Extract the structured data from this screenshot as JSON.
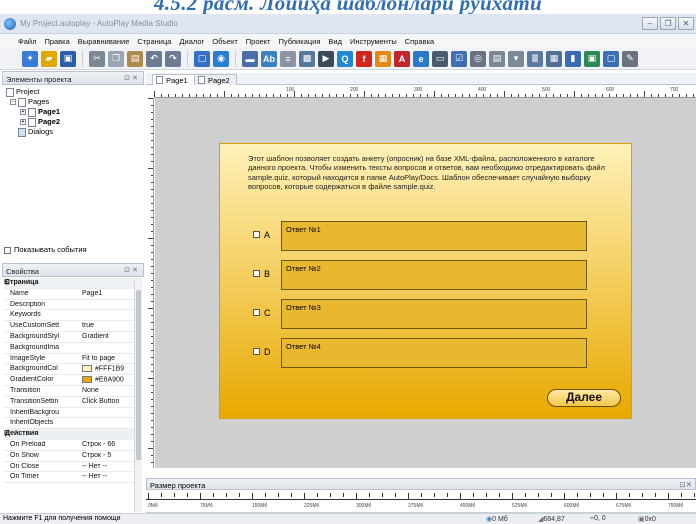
{
  "heading": "4.5.2 расм. Лойиҳа шаблонлари рўйхати",
  "window": {
    "title": "My Project.autoplay - AutoPlay Media Studio"
  },
  "menu": [
    "Файл",
    "Правка",
    "Выравнивание",
    "Страница",
    "Диалог",
    "Объект",
    "Проект",
    "Публикация",
    "Вид",
    "Инструменты",
    "Справка"
  ],
  "toolbar": {
    "buttons": [
      {
        "name": "wizard-icon",
        "color": "#3a7bd5",
        "glyph": "✦"
      },
      {
        "name": "open-icon",
        "color": "#e0a800",
        "glyph": "▰"
      },
      {
        "name": "save-icon",
        "color": "#2b5fa8",
        "glyph": "▣"
      },
      {
        "name": "cut-icon",
        "color": "#7b8794",
        "glyph": "✂"
      },
      {
        "name": "copy-icon",
        "color": "#9aa5b1",
        "glyph": "❐"
      },
      {
        "name": "paste-icon",
        "color": "#b08a4a",
        "glyph": "▤"
      },
      {
        "name": "undo-icon",
        "color": "#6b7c93",
        "glyph": "↶"
      },
      {
        "name": "redo-icon",
        "color": "#6b7c93",
        "glyph": "↷"
      },
      {
        "name": "page-icon",
        "color": "#3570c4",
        "glyph": "▢"
      },
      {
        "name": "globe-icon",
        "color": "#2a7fd4",
        "glyph": "◉"
      },
      {
        "name": "button-object-icon",
        "color": "#4a6fa5",
        "glyph": "▬"
      },
      {
        "name": "label-object-icon",
        "color": "#3b82c4",
        "glyph": "Ab"
      },
      {
        "name": "paragraph-object-icon",
        "color": "#8a94a3",
        "glyph": "≡"
      },
      {
        "name": "image-object-icon",
        "color": "#56799e",
        "glyph": "▩"
      },
      {
        "name": "video-object-icon",
        "color": "#3a4b5c",
        "glyph": "▶"
      },
      {
        "name": "web-object-icon",
        "color": "#1f8ad1",
        "glyph": "Q"
      },
      {
        "name": "flash-object-icon",
        "color": "#d0261c",
        "glyph": "f"
      },
      {
        "name": "slideshow-object-icon",
        "color": "#e08a1a",
        "glyph": "▦"
      },
      {
        "name": "pdf-object-icon",
        "color": "#c0262b",
        "glyph": "A"
      },
      {
        "name": "xbutton-object-icon",
        "color": "#2c78c8",
        "glyph": "e"
      },
      {
        "name": "input-object-icon",
        "color": "#4a5b70",
        "glyph": "▭"
      },
      {
        "name": "checkbox-object-icon",
        "color": "#3e6fb0",
        "glyph": "☑"
      },
      {
        "name": "radio-object-icon",
        "color": "#6b7280",
        "glyph": "◎"
      },
      {
        "name": "listbox-object-icon",
        "color": "#7a8898",
        "glyph": "▤"
      },
      {
        "name": "combobox-object-icon",
        "color": "#7a8898",
        "glyph": "▾"
      },
      {
        "name": "tree-object-icon",
        "color": "#5a7aa0",
        "glyph": "≣"
      },
      {
        "name": "grid-object-icon",
        "color": "#4f6f94",
        "glyph": "▦"
      },
      {
        "name": "progress-object-icon",
        "color": "#3a6ab0",
        "glyph": "▮"
      },
      {
        "name": "plugin-object-icon",
        "color": "#2b8a55",
        "glyph": "▣"
      },
      {
        "name": "shape-object-icon",
        "color": "#3c6fb3",
        "glyph": "▢"
      },
      {
        "name": "pencil-icon",
        "color": "#6b7280",
        "glyph": "✎"
      }
    ]
  },
  "project_panel": {
    "title": "Элементы проекта",
    "tree": {
      "root": "Project",
      "pages": "Pages",
      "page1": "Page1",
      "page2": "Page2",
      "dialogs": "Dialogs"
    },
    "show_events": "Показывать события"
  },
  "properties_panel": {
    "title": "Свойства",
    "rows": [
      {
        "cat": true,
        "k": "Страница"
      },
      {
        "k": "Name",
        "v": "Page1"
      },
      {
        "k": "Description",
        "v": ""
      },
      {
        "k": "Keywords",
        "v": ""
      },
      {
        "k": "UseCustomSett",
        "v": "true"
      },
      {
        "k": "BackgroundStyl",
        "v": "Gradient"
      },
      {
        "k": "BackgroundIma",
        "v": ""
      },
      {
        "k": "ImageStyle",
        "v": "Fit to page"
      },
      {
        "k": "BackgroundCol",
        "v": "#FFF1B9",
        "swatch": "#FFF1B9"
      },
      {
        "k": "GradientColor",
        "v": "#E8A900",
        "swatch": "#E8A900"
      },
      {
        "k": "Transition",
        "v": "None"
      },
      {
        "k": "TransitionSettin",
        "v": "Click Button"
      },
      {
        "k": "InheritBackgrou",
        "v": ""
      },
      {
        "k": "InheritObjects",
        "v": ""
      },
      {
        "cat": true,
        "k": "Действия"
      },
      {
        "k": "On Preload",
        "v": "Строк - 66"
      },
      {
        "k": "On Show",
        "v": "Строк - 5"
      },
      {
        "k": "On Close",
        "v": "-- Нет --"
      },
      {
        "k": "On Timer",
        "v": "-- Нет --"
      }
    ]
  },
  "tabs": [
    "Page1",
    "Page2"
  ],
  "ruler": {
    "h_labels": [
      "100",
      "200",
      "300",
      "400",
      "500",
      "600",
      "700"
    ]
  },
  "page": {
    "intro": "Этот шаблон позволяет создать анкету (опросник) на базе XML-файла, расположенного в каталоге данного проекта. Чтобы изменить тексты вопросов и ответов, вам необходимо отредактировать файл sample.quiz, который находится в папке AutoPlay/Docs. Шаблон обеспечивает случайную выборку вопросов, которые содержаться в файле sample.quiz.",
    "options": [
      {
        "letter": "A",
        "text": "Ответ №1"
      },
      {
        "letter": "B",
        "text": "Ответ №2"
      },
      {
        "letter": "C",
        "text": "Ответ №3"
      },
      {
        "letter": "D",
        "text": "Ответ №4"
      }
    ],
    "next": "Далее",
    "background": "#FFF1B9",
    "gradient": "#E8A900"
  },
  "size_panel": {
    "title": "Размер проекта",
    "labels": [
      "0Mб",
      "75Mб",
      "150Mб",
      "225Mб",
      "300Mб",
      "375Mб",
      "450Mб",
      "525Mб",
      "600Mб",
      "675Mб",
      "750Mб"
    ]
  },
  "status": {
    "hint": "Нажмите F1 для получения помощи",
    "size": "0 Mб",
    "coords": "684,87",
    "pos": "0, 0",
    "dims": "0x0"
  }
}
